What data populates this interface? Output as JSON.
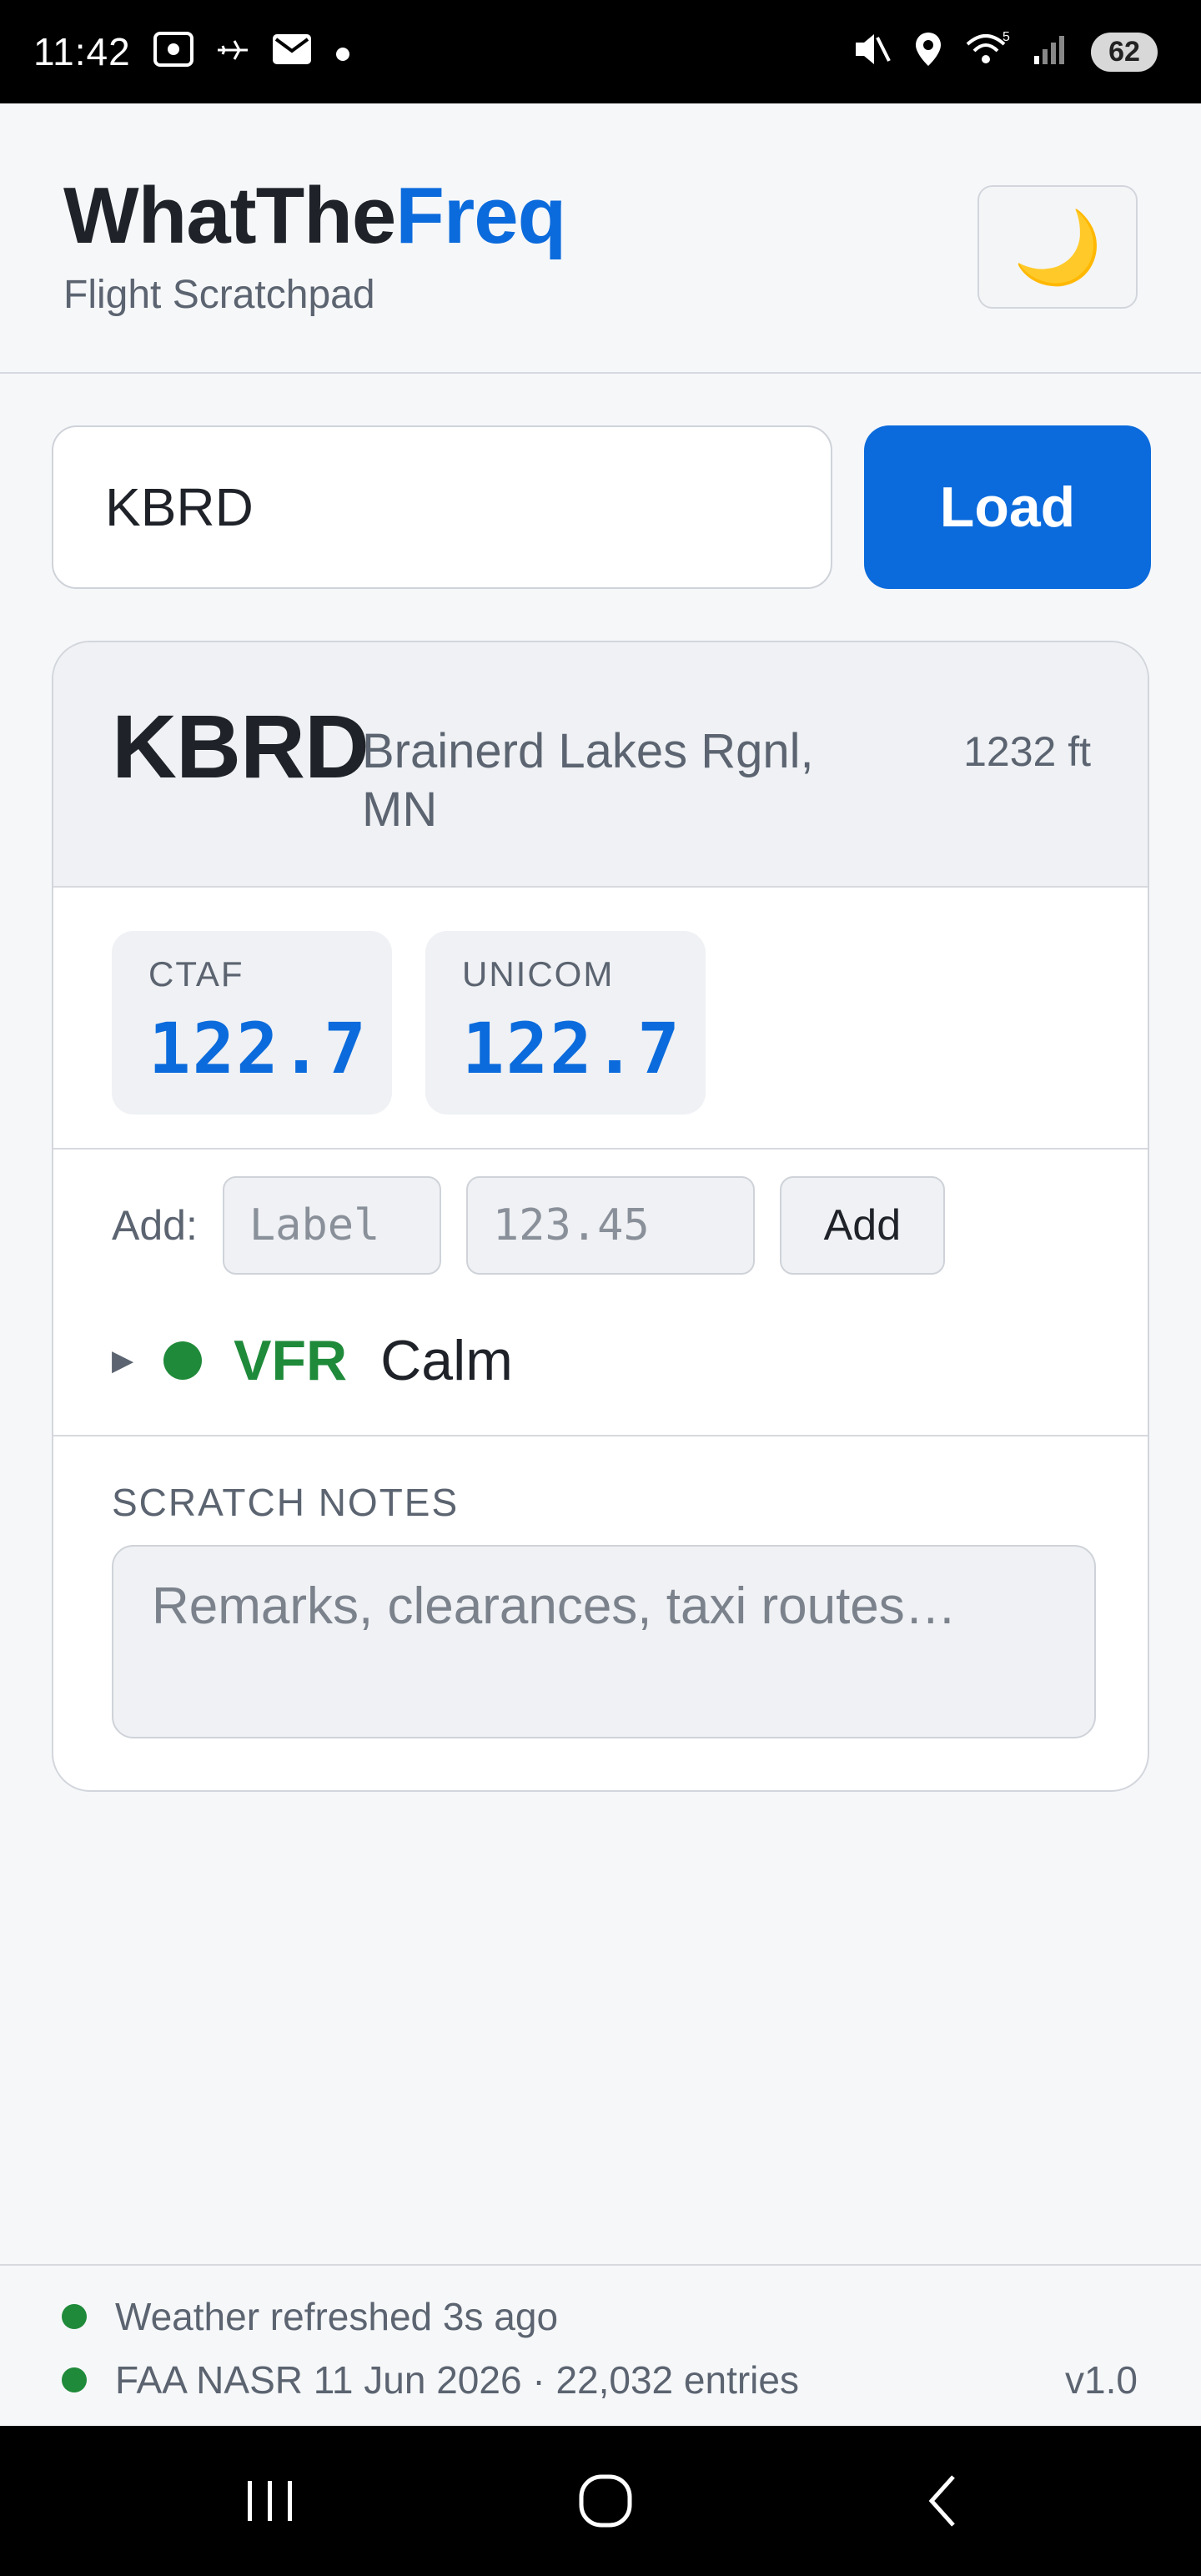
{
  "status_bar": {
    "time": "11:42",
    "battery": "62",
    "icons": [
      "screenshot-icon",
      "airplane-icon",
      "mail-icon",
      "dot-icon",
      "mute-icon",
      "location-icon",
      "wifi-icon",
      "signal-icon",
      "battery-icon"
    ]
  },
  "header": {
    "brand_part1": "WhatThe",
    "brand_part2": "Freq",
    "tagline": "Flight Scratchpad",
    "theme_toggle_icon": "🌙"
  },
  "search": {
    "value": "KBRD",
    "load_label": "Load"
  },
  "airport": {
    "ident": "KBRD",
    "name": "Brainerd Lakes Rgnl, MN",
    "elevation": "1232 ft",
    "frequencies": [
      {
        "label": "CTAF",
        "value": "122.7"
      },
      {
        "label": "UNICOM",
        "value": "122.7"
      }
    ]
  },
  "add_freq": {
    "label": "Add:",
    "label_placeholder": "Label",
    "freq_placeholder": "123.45",
    "button": "Add"
  },
  "weather": {
    "category": "VFR",
    "condition": "Calm",
    "category_color": "#1f8a3a"
  },
  "notes": {
    "label": "SCRATCH NOTES",
    "placeholder": "Remarks, clearances, taxi routes…"
  },
  "footer": {
    "weather_status": "Weather refreshed 3s ago",
    "db_status": "FAA NASR 11 Jun 2026 · 22,032 entries",
    "version": "v1.0"
  },
  "colors": {
    "accent": "#0b6bdc",
    "vfr_green": "#1f8a3a"
  }
}
